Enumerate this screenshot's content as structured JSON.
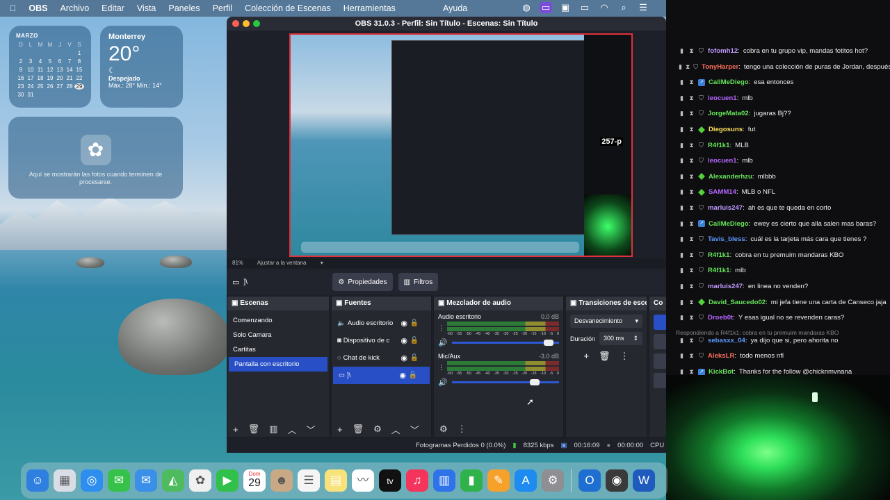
{
  "menubar": {
    "app": "OBS",
    "items": [
      "Archivo",
      "Editar",
      "Vista",
      "Paneles",
      "Perfil",
      "Colección de Escenas",
      "Herramientas"
    ],
    "help": "Ayuda"
  },
  "calendar": {
    "month": "MARZO",
    "weekdays": [
      "D",
      "L",
      "M",
      "M",
      "J",
      "V",
      "S"
    ],
    "days": [
      "",
      "",
      "",
      "",
      "",
      "",
      "1",
      "2",
      "3",
      "4",
      "5",
      "6",
      "7",
      "8",
      "9",
      "10",
      "11",
      "12",
      "13",
      "14",
      "15",
      "16",
      "17",
      "18",
      "19",
      "20",
      "21",
      "22",
      "23",
      "24",
      "25",
      "26",
      "27",
      "28",
      "29",
      "30",
      "31"
    ],
    "today": "29"
  },
  "weather": {
    "city": "Monterrey",
    "temp": "20°",
    "condition": "Despejado",
    "hilo": "Máx.: 28° Mín.: 14°"
  },
  "photos_widget": {
    "text": "Aquí se mostrarán las fotos cuando terminen de procesarse."
  },
  "obs": {
    "title": "OBS 31.0.3 - Perfil: Sin Título - Escenas: Sin Título",
    "zoom": "81%",
    "fit": "Ajustar a la ventana",
    "properties_button": "Propiedades",
    "filters_button": "Filtros",
    "source_name": "]\\",
    "panels": {
      "scenes": "Escenas",
      "sources": "Fuentes",
      "mixer": "Mezclador de audio",
      "transitions": "Transiciones de esce…",
      "controls": "Co"
    },
    "scenes": [
      "Comenzando",
      "Solo Camara",
      "Cartitas",
      "Pantalla con escritorio"
    ],
    "sources": [
      "Audio escritorio",
      "Dispositivo de c",
      "Chat de kick",
      "]\\"
    ],
    "mixer": [
      {
        "name": "Audio escritorio",
        "db": "0.0 dB",
        "level": 0.95
      },
      {
        "name": "Mic/Aux",
        "db": "-3.0 dB",
        "level": 0.82
      }
    ],
    "mixer_scale": [
      "-60",
      "-55",
      "-50",
      "-45",
      "-40",
      "-35",
      "-30",
      "-25",
      "-20",
      "-15",
      "-10",
      "-5",
      "0"
    ],
    "transition": {
      "selected": "Desvanecimiento",
      "duration_label": "Duración",
      "duration_value": "300 ms"
    },
    "status": {
      "dropped": "Fotogramas Perdidos 0 (0.0%)",
      "bitrate": "8325 kbps",
      "time1": "00:16:09",
      "time2": "00:00:00",
      "cpu": "CPU"
    }
  },
  "preview_overlay": {
    "text": "257-p"
  },
  "chat": {
    "messages": [
      {
        "user": "fofomh12",
        "color": "#c19bff",
        "text": "cobra en tu grupo vip, mandas fotitos hot?",
        "badge": "shield"
      },
      {
        "user": "TonyHarper",
        "color": "#ff6e5b",
        "text": "tengo una colección de puras de Jordan, después",
        "badge": "shield"
      },
      {
        "user": "CallMeDiego",
        "color": "#67e65b",
        "text": "esa entonces",
        "badge": "blue"
      },
      {
        "user": "leocuen1",
        "color": "#b566ff",
        "text": "mlb",
        "badge": "shield"
      },
      {
        "user": "JorgeMata02",
        "color": "#67e65b",
        "text": "jugaras Bj??",
        "badge": "shield"
      },
      {
        "user": "Diegosuns",
        "color": "#ffe15b",
        "text": "fut",
        "badge": "green"
      },
      {
        "user": "R4f1k1",
        "color": "#67e65b",
        "text": "MLB",
        "badge": "shield"
      },
      {
        "user": "leocuen1",
        "color": "#b566ff",
        "text": "mlb",
        "badge": "shield"
      },
      {
        "user": "Alexanderhzu",
        "color": "#67e65b",
        "text": "mlbbb",
        "badge": "green"
      },
      {
        "user": "SAMM14",
        "color": "#b566ff",
        "text": "MLB o NFL",
        "badge": "green"
      },
      {
        "user": "marluis247",
        "color": "#c19bff",
        "text": "ah es que te queda en corto",
        "badge": "shield"
      },
      {
        "user": "CallMeDiego",
        "color": "#67e65b",
        "text": "ewey es cierto que alla salen mas baras?",
        "badge": "blue"
      },
      {
        "user": "Tavis_bless",
        "color": "#5b9bff",
        "text": "cuál es la tarjeta más cara que tienes ?",
        "badge": "shield"
      },
      {
        "user": "R4f1k1",
        "color": "#67e65b",
        "text": "cobra en tu premuim mandaras KBO",
        "badge": "shield"
      },
      {
        "user": "R4f1k1",
        "color": "#67e65b",
        "text": "mlb",
        "badge": "shield"
      },
      {
        "user": "marluis247",
        "color": "#c19bff",
        "text": "en linea no venden?",
        "badge": "shield"
      },
      {
        "user": "David_Saucedo02",
        "color": "#67e65b",
        "text": "mi jefa tiene una carta de Canseco jaja",
        "badge": "green"
      },
      {
        "user": "Droeb0t",
        "color": "#b566ff",
        "text": "Y esas igual no se revenden caras?",
        "badge": "shield"
      },
      {
        "user": "sebasxx_04",
        "color": "#5b9bff",
        "text": "ya dijo que si, pero ahorita no",
        "badge": "shield"
      },
      {
        "user": "AleksLR",
        "color": "#ff6e5b",
        "text": "todo menos nfl",
        "badge": "shield"
      },
      {
        "user": "KickBot",
        "color": "#67e65b",
        "text": "Thanks for the follow @chicknmvnana",
        "badge": "blue"
      }
    ],
    "reply": "Respondiendo a R4f1k1: cobra en tu premuim mandaras KBO"
  },
  "dock": {
    "icons": [
      "finder-icon",
      "launchpad-icon",
      "safari-icon",
      "messages-icon",
      "mail-icon",
      "maps-icon",
      "photos-icon",
      "facetime-icon",
      "calendar-icon",
      "contacts-icon",
      "reminders-icon",
      "notes-icon",
      "freeform-icon",
      "tv-icon",
      "music-icon",
      "keynote-icon",
      "numbers-icon",
      "pages-icon",
      "appstore-icon",
      "settings-icon",
      "outlook-icon",
      "obs-icon",
      "word-icon"
    ],
    "calendar_month": "Dom",
    "calendar_day": "29",
    "tv_label": "tv"
  }
}
